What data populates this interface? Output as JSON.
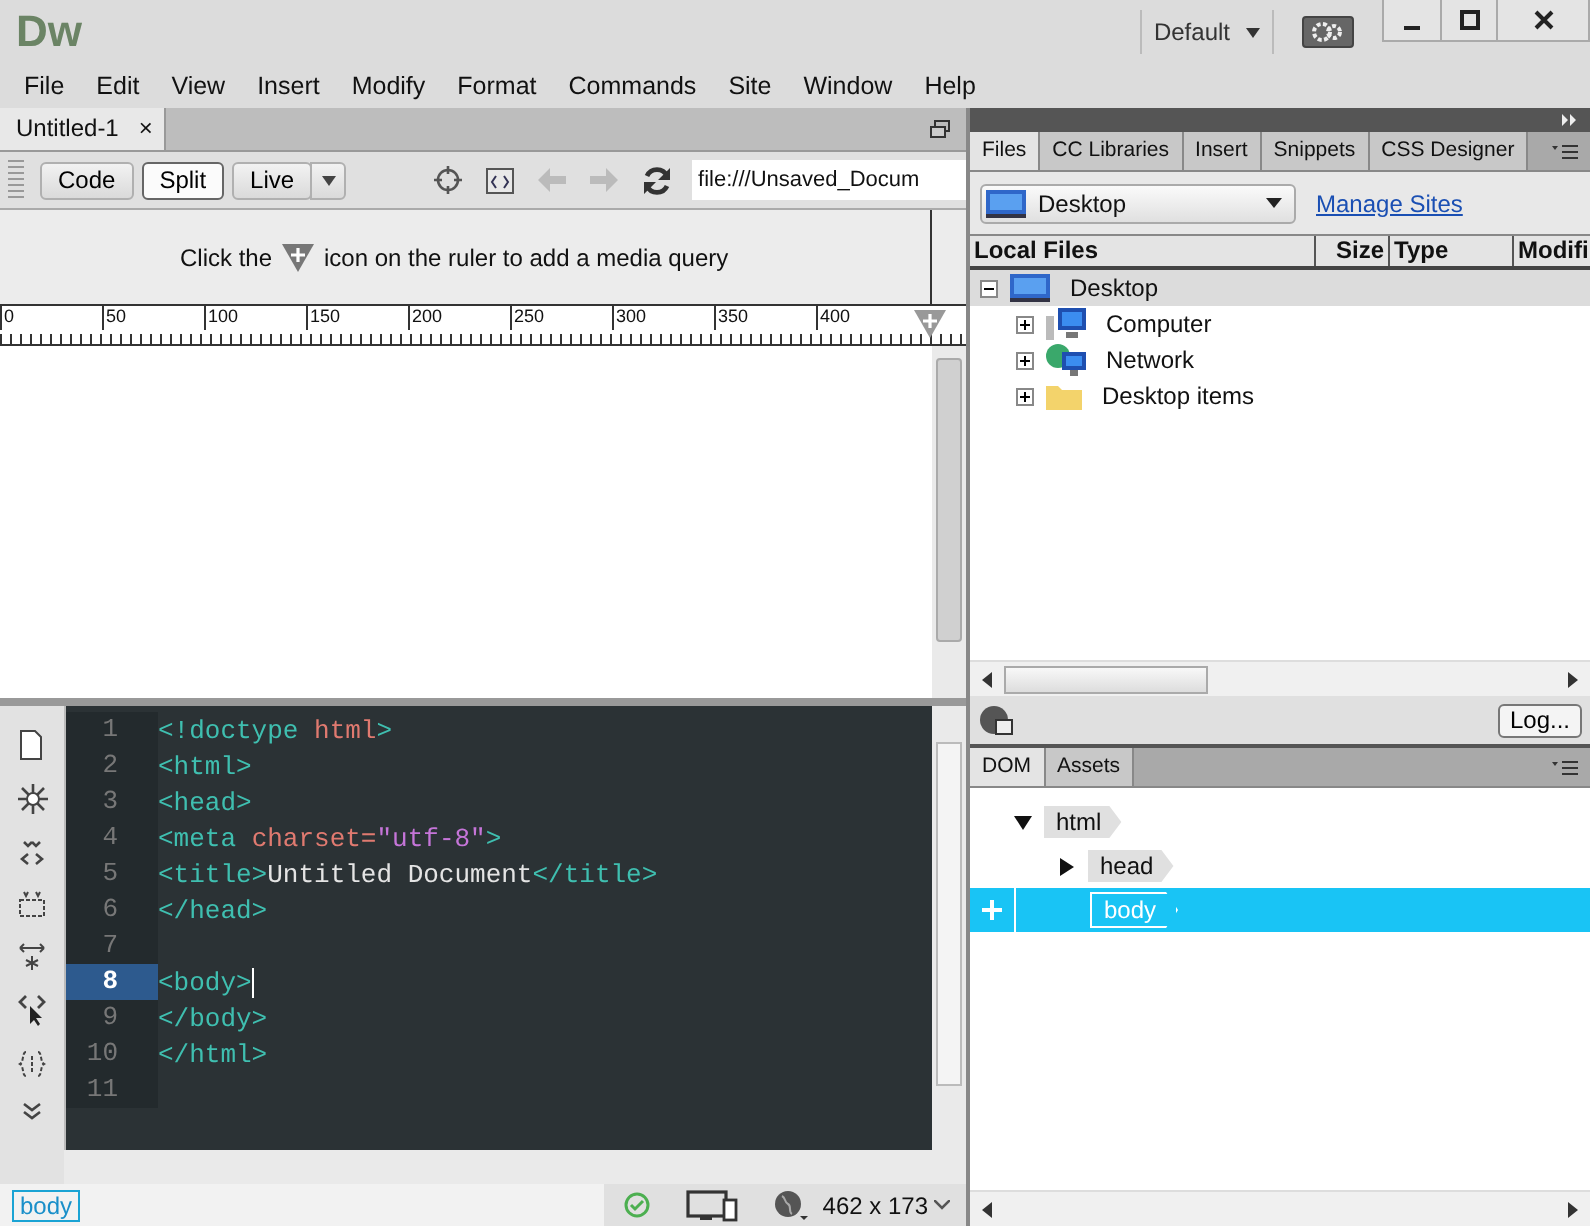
{
  "app": {
    "logo": "Dw",
    "workspace": "Default"
  },
  "menu": [
    "File",
    "Edit",
    "View",
    "Insert",
    "Modify",
    "Format",
    "Commands",
    "Site",
    "Window",
    "Help"
  ],
  "document_tabs": [
    {
      "label": "Untitled-1",
      "close": "×",
      "selected": true
    }
  ],
  "toolbar": {
    "views": [
      {
        "label": "Code",
        "selected": false
      },
      {
        "label": "Split",
        "selected": true
      },
      {
        "label": "Live",
        "selected": false
      }
    ],
    "address": "file:///Unsaved_Docum"
  },
  "media_query_hint": {
    "before": "Click the",
    "after": "icon on the ruler to add a media query"
  },
  "ruler": {
    "ticks": [
      "0",
      "50",
      "100",
      "150",
      "200",
      "250",
      "300",
      "350",
      "400"
    ]
  },
  "code_lines": [
    {
      "number": "1",
      "current": false,
      "tokens": [
        {
          "kind": "tag",
          "text": "<!doctype "
        },
        {
          "kind": "attr",
          "text": "html"
        },
        {
          "kind": "tag",
          "text": ">"
        }
      ]
    },
    {
      "number": "2",
      "current": false,
      "tokens": [
        {
          "kind": "tag",
          "text": "<html>"
        }
      ]
    },
    {
      "number": "3",
      "current": false,
      "tokens": [
        {
          "kind": "tag",
          "text": "<head>"
        }
      ]
    },
    {
      "number": "4",
      "current": false,
      "tokens": [
        {
          "kind": "tag",
          "text": "<meta "
        },
        {
          "kind": "attr",
          "text": "charset="
        },
        {
          "kind": "value",
          "text": "\"utf-8\""
        },
        {
          "kind": "tag",
          "text": ">"
        }
      ]
    },
    {
      "number": "5",
      "current": false,
      "tokens": [
        {
          "kind": "tag",
          "text": "<title>"
        },
        {
          "kind": "text",
          "text": "Untitled Document"
        },
        {
          "kind": "tag",
          "text": "</title>"
        }
      ]
    },
    {
      "number": "6",
      "current": false,
      "tokens": [
        {
          "kind": "tag",
          "text": "</head>"
        }
      ]
    },
    {
      "number": "7",
      "current": false
    },
    {
      "number": "8",
      "current": true,
      "tokens": [
        {
          "kind": "tag",
          "text": "<body>"
        }
      ]
    },
    {
      "number": "9",
      "current": false,
      "tokens": [
        {
          "kind": "tag",
          "text": "</body>"
        }
      ]
    },
    {
      "number": "10",
      "current": false,
      "tokens": [
        {
          "kind": "tag",
          "text": "</html>"
        }
      ]
    },
    {
      "number": "11",
      "current": false
    }
  ],
  "status_bar": {
    "tag": "body",
    "size": "462 x 173"
  },
  "files_panel": {
    "tabs": [
      {
        "label": "Files",
        "selected": true
      },
      {
        "label": "CC Libraries",
        "selected": false
      },
      {
        "label": "Insert",
        "selected": false
      },
      {
        "label": "Snippets",
        "selected": false
      },
      {
        "label": "CSS Designer",
        "selected": false
      }
    ],
    "site": "Desktop",
    "manage_link": "Manage Sites",
    "columns": [
      "Local Files",
      "Size",
      "Type",
      "Modifi"
    ],
    "tree": [
      {
        "label": "Desktop",
        "expanded": true,
        "selected": true,
        "children": [
          {
            "label": "Computer",
            "expanded": false,
            "selected": false
          },
          {
            "label": "Network",
            "expanded": false,
            "selected": false
          },
          {
            "label": "Desktop items",
            "expanded": false,
            "selected": false
          }
        ]
      }
    ],
    "log_button": "Log..."
  },
  "dom_panel": {
    "tabs": [
      {
        "label": "DOM",
        "selected": true
      },
      {
        "label": "Assets",
        "selected": false
      }
    ],
    "tree": [
      {
        "tag": "html",
        "expanded": true,
        "selected": false,
        "children": [
          {
            "tag": "head",
            "expanded": false,
            "selected": false
          },
          {
            "tag": "body",
            "selected": true
          }
        ]
      }
    ]
  }
}
